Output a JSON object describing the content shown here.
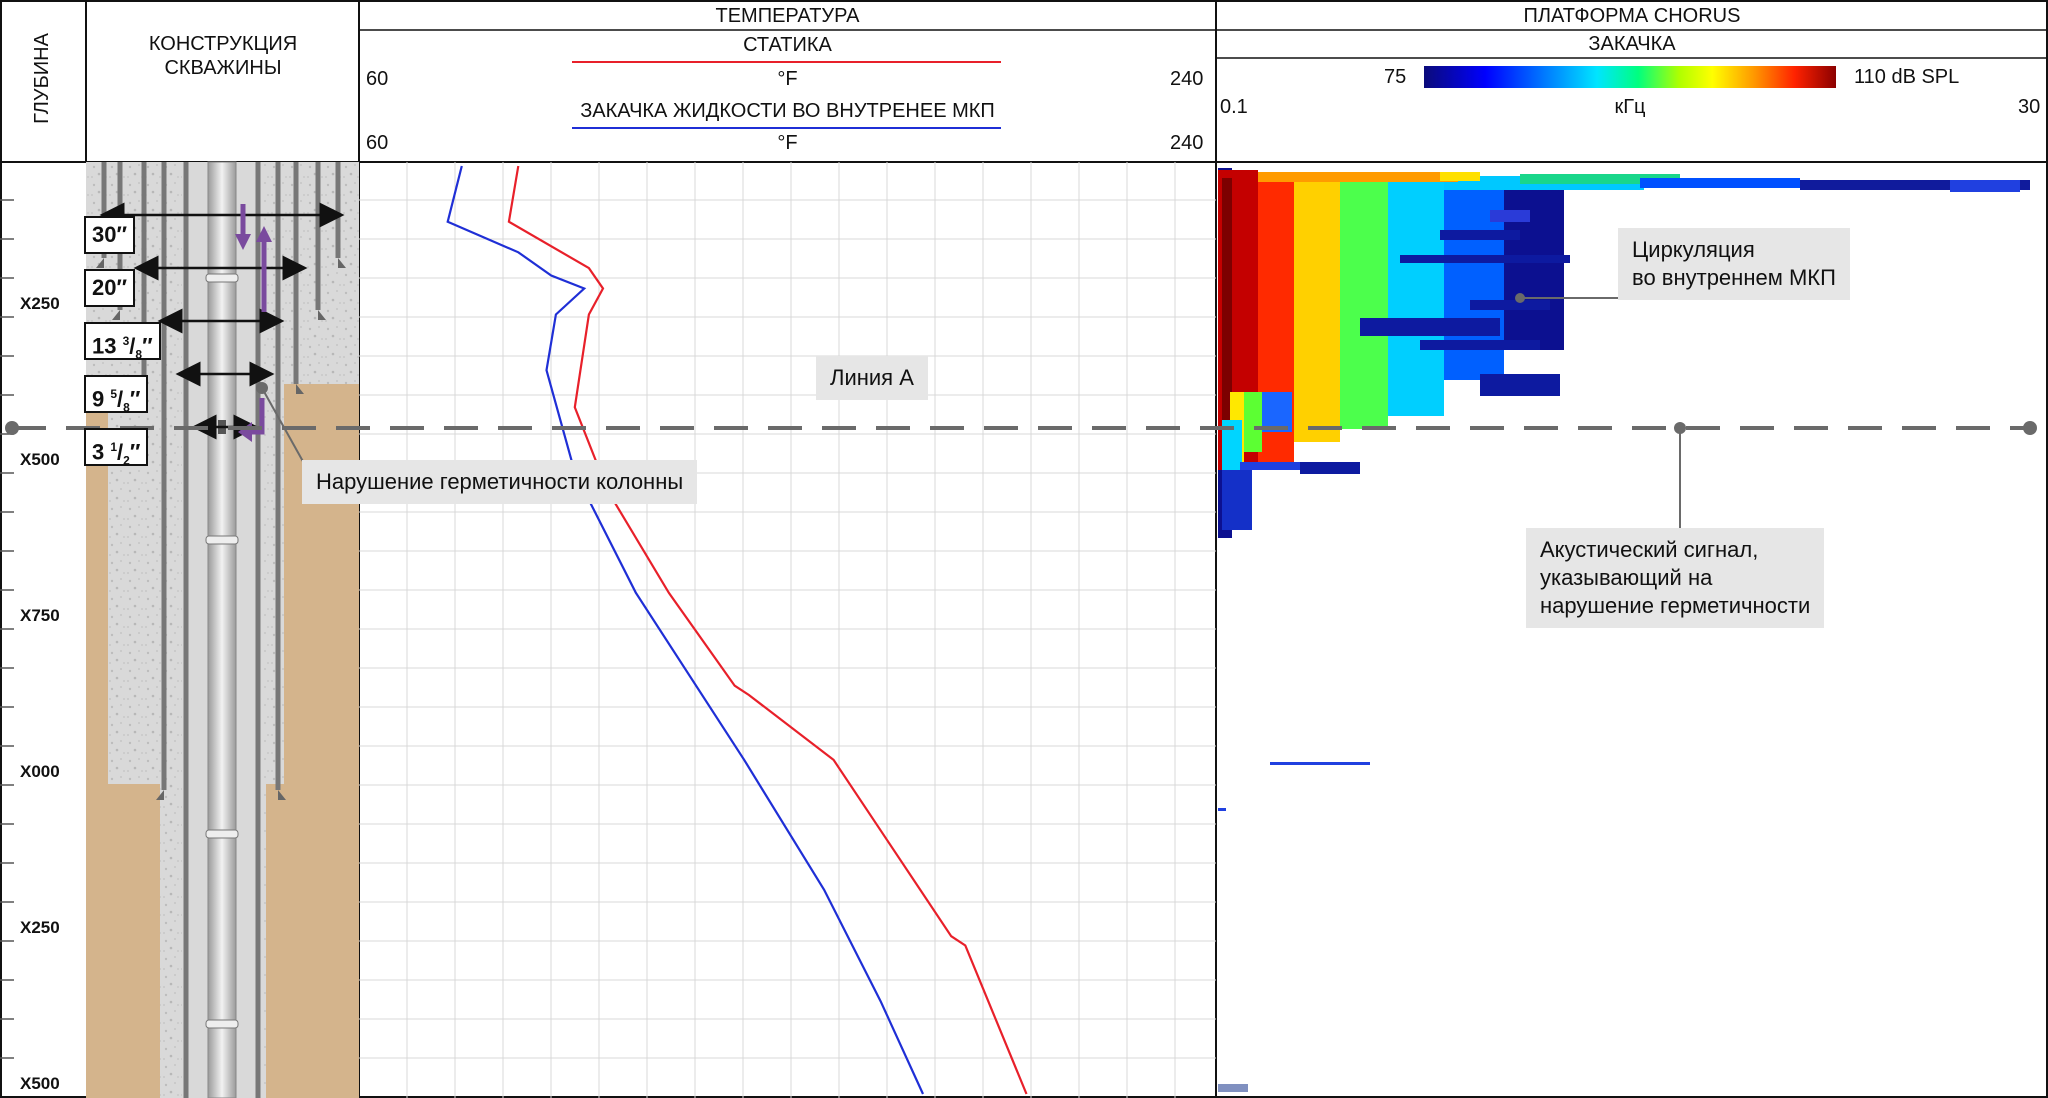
{
  "header": {
    "depth_title": "ГЛУБИНА",
    "construction_title": "КОНСТРУКЦИЯ СКВАЖИНЫ",
    "temperature_title": "ТЕМПЕРАТУРА",
    "chorus_title": "ПЛАТФОРМА CHORUS"
  },
  "temperature": {
    "static_label": "СТАТИКА",
    "static_color": "#e8202a",
    "static_min": "60",
    "static_max": "240",
    "static_unit": "°F",
    "injection_label": "ЗАКАЧКА ЖИДКОСТИ ВО ВНУТРЕНЕЕ МКП",
    "injection_color": "#1f2fd6",
    "injection_min": "60",
    "injection_max": "240",
    "injection_unit": "°F"
  },
  "chorus": {
    "mode_label": "ЗАКАЧКА",
    "colorbar_min": "75",
    "colorbar_max": "110 dB SPL",
    "freq_min": "0.1",
    "freq_max": "30",
    "freq_unit": "кГц"
  },
  "depth_labels": [
    "X250",
    "X500",
    "X750",
    "X000",
    "X250",
    "X500"
  ],
  "casing_sizes": {
    "c30_main": "30",
    "c30_mark": "′′",
    "c20_main": "20",
    "c20_mark": "′′",
    "c13_main": "13 ",
    "c13_num": "3",
    "c13_den": "8",
    "c13_mark": "′′",
    "c9_main": "9 ",
    "c9_num": "5",
    "c9_den": "8",
    "c9_mark": "′′",
    "c3_main": "3 ",
    "c3_num": "1",
    "c3_den": "2",
    "c3_mark": "′′"
  },
  "callouts": {
    "line_a": "Линия А",
    "leak": "Нарушение герметичности колонны",
    "circulation_1": "Циркуляция",
    "circulation_2": "во внутреннем МКП",
    "acoustic_1": "Акустический сигнал,",
    "acoustic_2": "указывающий на",
    "acoustic_3": "нарушение герметичности"
  },
  "chart_data": {
    "type": "line",
    "x_range": [
      60,
      240
    ],
    "x_unit": "°F",
    "series": [
      {
        "name": "СТАТИКА",
        "color": "#e8202a",
        "points": [
          {
            "temp": 93,
            "depth": 0.0
          },
          {
            "temp": 91,
            "depth": 0.06
          },
          {
            "temp": 108,
            "depth": 0.11
          },
          {
            "temp": 111,
            "depth": 0.132
          },
          {
            "temp": 108,
            "depth": 0.16
          },
          {
            "temp": 105,
            "depth": 0.26
          },
          {
            "temp": 112,
            "depth": 0.35
          },
          {
            "temp": 125,
            "depth": 0.46
          },
          {
            "temp": 139,
            "depth": 0.56
          },
          {
            "temp": 142,
            "depth": 0.57
          },
          {
            "temp": 160,
            "depth": 0.64
          },
          {
            "temp": 185,
            "depth": 0.83
          },
          {
            "temp": 188,
            "depth": 0.84
          },
          {
            "temp": 201,
            "depth": 1.0
          }
        ]
      },
      {
        "name": "ЗАКАЧКА ЖИДКОСТИ ВО ВНУТРЕНЕЕ МКП",
        "color": "#1f2fd6",
        "points": [
          {
            "temp": 81,
            "depth": 0.0
          },
          {
            "temp": 78,
            "depth": 0.06
          },
          {
            "temp": 93,
            "depth": 0.093
          },
          {
            "temp": 100,
            "depth": 0.118
          },
          {
            "temp": 107,
            "depth": 0.132
          },
          {
            "temp": 101,
            "depth": 0.16
          },
          {
            "temp": 99,
            "depth": 0.22
          },
          {
            "temp": 105,
            "depth": 0.33
          },
          {
            "temp": 118,
            "depth": 0.46
          },
          {
            "temp": 141,
            "depth": 0.64
          },
          {
            "temp": 158,
            "depth": 0.78
          },
          {
            "temp": 170,
            "depth": 0.9
          },
          {
            "temp": 179,
            "depth": 1.0
          }
        ]
      }
    ]
  }
}
